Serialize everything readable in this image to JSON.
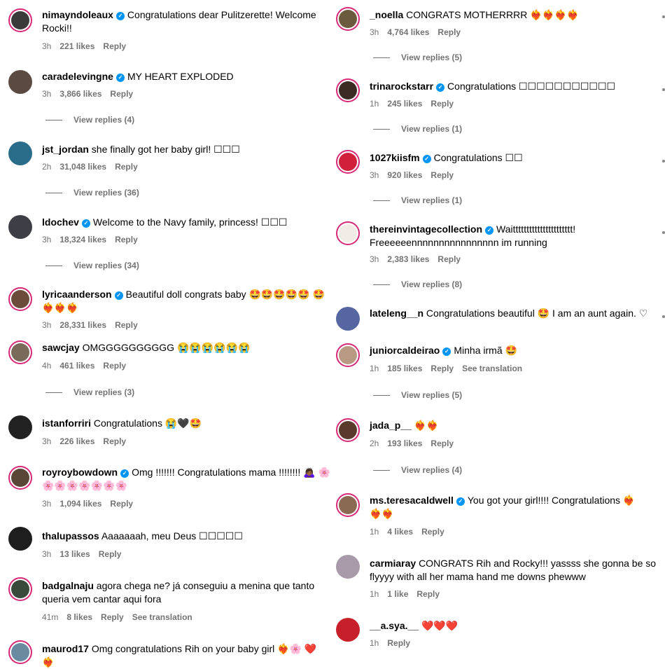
{
  "left": [
    {
      "user": "nimayndoleaux",
      "verified": true,
      "text": "Congratulations dear Pulitzerette! Welcome Rocki!!",
      "time": "3h",
      "likes": "221 likes",
      "reply": "Reply",
      "avatar_color": "#3a3a3a",
      "story": true
    },
    {
      "user": "caradelevingne",
      "verified": true,
      "text": "MY HEART EXPLODED",
      "time": "3h",
      "likes": "3,866 likes",
      "reply": "Reply",
      "replies": "View replies (4)",
      "avatar_color": "#5b4a42",
      "story": false
    },
    {
      "user": "jst_jordan",
      "verified": false,
      "text": "she finally got her baby girl! ☐☐☐",
      "time": "2h",
      "likes": "31,048 likes",
      "reply": "Reply",
      "replies": "View replies (36)",
      "avatar_color": "#2a6d8a",
      "story": false
    },
    {
      "user": "ldochev",
      "verified": true,
      "text": "Welcome to the Navy family, princess! ☐☐☐",
      "time": "3h",
      "likes": "18,324 likes",
      "reply": "Reply",
      "replies": "View replies (34)",
      "avatar_color": "#3e3e46",
      "story": false
    },
    {
      "user": "lyricaanderson",
      "verified": true,
      "text": "Beautiful doll congrats baby 🤩🤩🤩🤩🤩 🤩❤️‍🔥❤️‍🔥❤️‍🔥",
      "time": "3h",
      "likes": "28,331 likes",
      "reply": "Reply",
      "avatar_color": "#6b4c3b",
      "story": true
    },
    {
      "user": "sawcjay",
      "verified": false,
      "text": "OMGGGGGGGGGG 😭😭😭😭😭😭",
      "time": "4h",
      "likes": "461 likes",
      "reply": "Reply",
      "replies": "View replies (3)",
      "avatar_color": "#7a6a5a",
      "story": true
    },
    {
      "user": "istanforriri",
      "verified": false,
      "text": "Congratulations 😭🖤🤩",
      "time": "3h",
      "likes": "226 likes",
      "reply": "Reply",
      "avatar_color": "#222222",
      "story": false
    },
    {
      "user": "royroybowdown",
      "verified": true,
      "text": "Omg !!!!!!! Congratulations mama !!!!!!!! 🙇🏾‍♀️ 🌸🌸🌸🌸🌸🌸🌸🌸",
      "time": "3h",
      "likes": "1,094 likes",
      "reply": "Reply",
      "avatar_color": "#5a4636",
      "story": true
    },
    {
      "user": "thalupassos",
      "verified": false,
      "text": "Aaaaaaah, meu Deus ☐☐☐☐☐",
      "time": "3h",
      "likes": "13 likes",
      "reply": "Reply",
      "avatar_color": "#1e1e1e",
      "story": false
    },
    {
      "user": "badgalnaju",
      "verified": false,
      "text": "agora chega ne? já conseguiu a menina que tanto queria vem cantar aqui fora",
      "time": "41m",
      "likes": "8 likes",
      "reply": "Reply",
      "translate": "See translation",
      "avatar_color": "#3a4a3a",
      "story": true
    },
    {
      "user": "maurod17",
      "verified": false,
      "text": "Omg congratulations Rih on your baby girl ❤️‍🔥🌸 ❤️❤️‍🔥",
      "time": "",
      "likes": "",
      "reply": "",
      "avatar_color": "#6a8aa0",
      "story": true
    }
  ],
  "right": [
    {
      "user": "_noella",
      "verified": false,
      "text": "CONGRATS MOTHERRRR ❤️‍🔥❤️‍🔥❤️‍🔥❤️‍🔥",
      "time": "3h",
      "likes": "4,764 likes",
      "reply": "Reply",
      "replies": "View replies (5)",
      "avatar_color": "#6c5a3c",
      "story": true
    },
    {
      "user": "trinarockstarr",
      "verified": true,
      "text": "Congratulations ☐☐☐☐☐☐☐☐☐☐☐",
      "time": "1h",
      "likes": "245 likes",
      "reply": "Reply",
      "replies": "View replies (1)",
      "avatar_color": "#3c2a24",
      "story": true
    },
    {
      "user": "1027kiisfm",
      "verified": true,
      "text": "Congratulations ☐☐",
      "time": "3h",
      "likes": "920 likes",
      "reply": "Reply",
      "replies": "View replies (1)",
      "avatar_color": "#d0203a",
      "story": true
    },
    {
      "user": "thereinvintagecollection",
      "verified": true,
      "text": "Waitttttttttttttttttttttt! Freeeeeennnnnnnnnnnnnnnn im running",
      "time": "3h",
      "likes": "2,383 likes",
      "reply": "Reply",
      "replies": "View replies (8)",
      "avatar_color": "#f2ece6",
      "story": true
    },
    {
      "user": "lateleng__n",
      "verified": false,
      "text": "Congratulations beautiful 🤩 I am an aunt again. ♡",
      "time": "",
      "likes": "",
      "reply": "",
      "avatar_color": "#5566a0",
      "story": false
    },
    {
      "user": "juniorcaldeirao",
      "verified": true,
      "text": "Minha irmã 🤩",
      "time": "1h",
      "likes": "185 likes",
      "reply": "Reply",
      "translate": "See translation",
      "replies": "View replies (5)",
      "avatar_color": "#b89a84",
      "story": true
    },
    {
      "user": "jada_p__",
      "verified": false,
      "text": "❤️‍🔥❤️‍🔥",
      "time": "2h",
      "likes": "193 likes",
      "reply": "Reply",
      "replies": "View replies (4)",
      "avatar_color": "#5a3a2a",
      "story": true
    },
    {
      "user": "ms.teresacaldwell",
      "verified": true,
      "text": "You got your girl!!!! Congratulations ❤️‍🔥❤️‍🔥❤️‍🔥",
      "time": "1h",
      "likes": "4 likes",
      "reply": "Reply",
      "avatar_color": "#8a6a52",
      "story": true
    },
    {
      "user": "carmiaray",
      "verified": false,
      "text": "CONGRATS Rih and Rocky!!! yassss she gonna be so flyyyy with all her mama hand me downs phewww",
      "time": "1h",
      "likes": "1 like",
      "reply": "Reply",
      "avatar_color": "#a89aa8",
      "story": false
    },
    {
      "user": "__a.sya.__",
      "verified": false,
      "text": "❤️❤️❤️",
      "time": "1h",
      "likes": "",
      "reply": "Reply",
      "avatar_color": "#c8202a",
      "story": false
    }
  ]
}
